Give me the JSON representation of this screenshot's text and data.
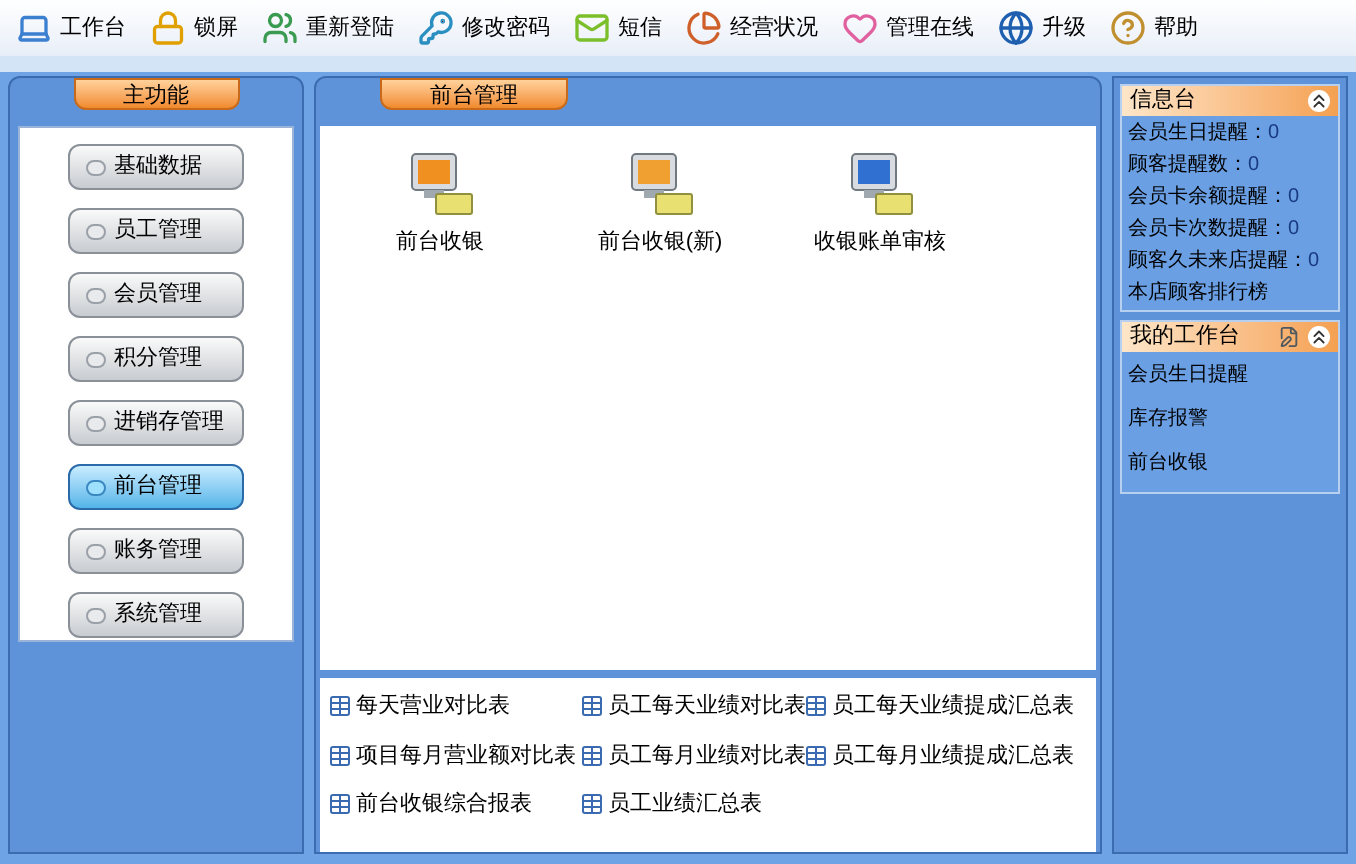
{
  "toolbar": [
    {
      "label": "工作台"
    },
    {
      "label": "锁屏"
    },
    {
      "label": "重新登陆"
    },
    {
      "label": "修改密码"
    },
    {
      "label": "短信"
    },
    {
      "label": "经营状况"
    },
    {
      "label": "管理在线"
    },
    {
      "label": "升级"
    },
    {
      "label": "帮助"
    }
  ],
  "sidebar": {
    "title": "主功能",
    "items": [
      {
        "label": "基础数据",
        "selected": false
      },
      {
        "label": "员工管理",
        "selected": false
      },
      {
        "label": "会员管理",
        "selected": false
      },
      {
        "label": "积分管理",
        "selected": false
      },
      {
        "label": "进销存管理",
        "selected": false
      },
      {
        "label": "前台管理",
        "selected": true
      },
      {
        "label": "账务管理",
        "selected": false
      },
      {
        "label": "系统管理",
        "selected": false
      }
    ]
  },
  "main": {
    "title": "前台管理",
    "modules": [
      {
        "label": "前台收银"
      },
      {
        "label": "前台收银(新)"
      },
      {
        "label": "收银账单审核"
      }
    ],
    "reports": [
      {
        "label": "每天营业对比表"
      },
      {
        "label": "员工每天业绩对比表"
      },
      {
        "label": "员工每天业绩提成汇总表"
      },
      {
        "label": "项目每月营业额对比表"
      },
      {
        "label": "员工每月业绩对比表"
      },
      {
        "label": "员工每月业绩提成汇总表"
      },
      {
        "label": "前台收银综合报表"
      },
      {
        "label": "员工业绩汇总表"
      }
    ]
  },
  "info_panel": {
    "title": "信息台",
    "items": [
      {
        "label": "会员生日提醒：",
        "value": "0"
      },
      {
        "label": "顾客提醒数：",
        "value": "0"
      },
      {
        "label": "会员卡余额提醒：",
        "value": "0"
      },
      {
        "label": "会员卡次数提醒：",
        "value": "0"
      },
      {
        "label": "顾客久未来店提醒：",
        "value": "0"
      },
      {
        "label": "本店顾客排行榜"
      }
    ]
  },
  "workbench_panel": {
    "title": "我的工作台",
    "items": [
      {
        "label": "会员生日提醒"
      },
      {
        "label": "库存报警"
      },
      {
        "label": "前台收银"
      }
    ]
  }
}
